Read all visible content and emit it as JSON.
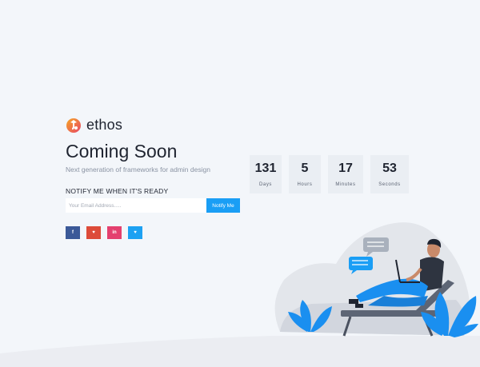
{
  "brand": {
    "name": "ethos",
    "logo_icon": "ethos-logo-icon"
  },
  "hero": {
    "title": "Coming Soon",
    "subtitle": "Next generation of frameworks for admin design"
  },
  "notify": {
    "label": "NOTIFY ME WHEN IT'S READY",
    "email_placeholder": "Your Email Address.....",
    "email_value": "",
    "button_label": "Notify Me"
  },
  "countdown": [
    {
      "value": "131",
      "label": "Days"
    },
    {
      "value": "5",
      "label": "Hours"
    },
    {
      "value": "17",
      "label": "Minutes"
    },
    {
      "value": "53",
      "label": "Seconds"
    }
  ],
  "socials": [
    {
      "name": "facebook",
      "glyph": "f",
      "color": "#3b5998",
      "icon": "facebook-icon"
    },
    {
      "name": "pinterest",
      "glyph": "♥",
      "color": "#dd4b39",
      "icon": "pinterest-icon"
    },
    {
      "name": "linkedin",
      "glyph": "in",
      "color": "#e4406f",
      "icon": "linkedin-icon"
    },
    {
      "name": "twitter",
      "glyph": "♥",
      "color": "#1da1f2",
      "icon": "twitter-icon"
    }
  ],
  "colors": {
    "accent": "#1a9ef5",
    "background": "#f3f6fa",
    "logo_orange": "#f5893a",
    "logo_pink": "#e8476a"
  }
}
